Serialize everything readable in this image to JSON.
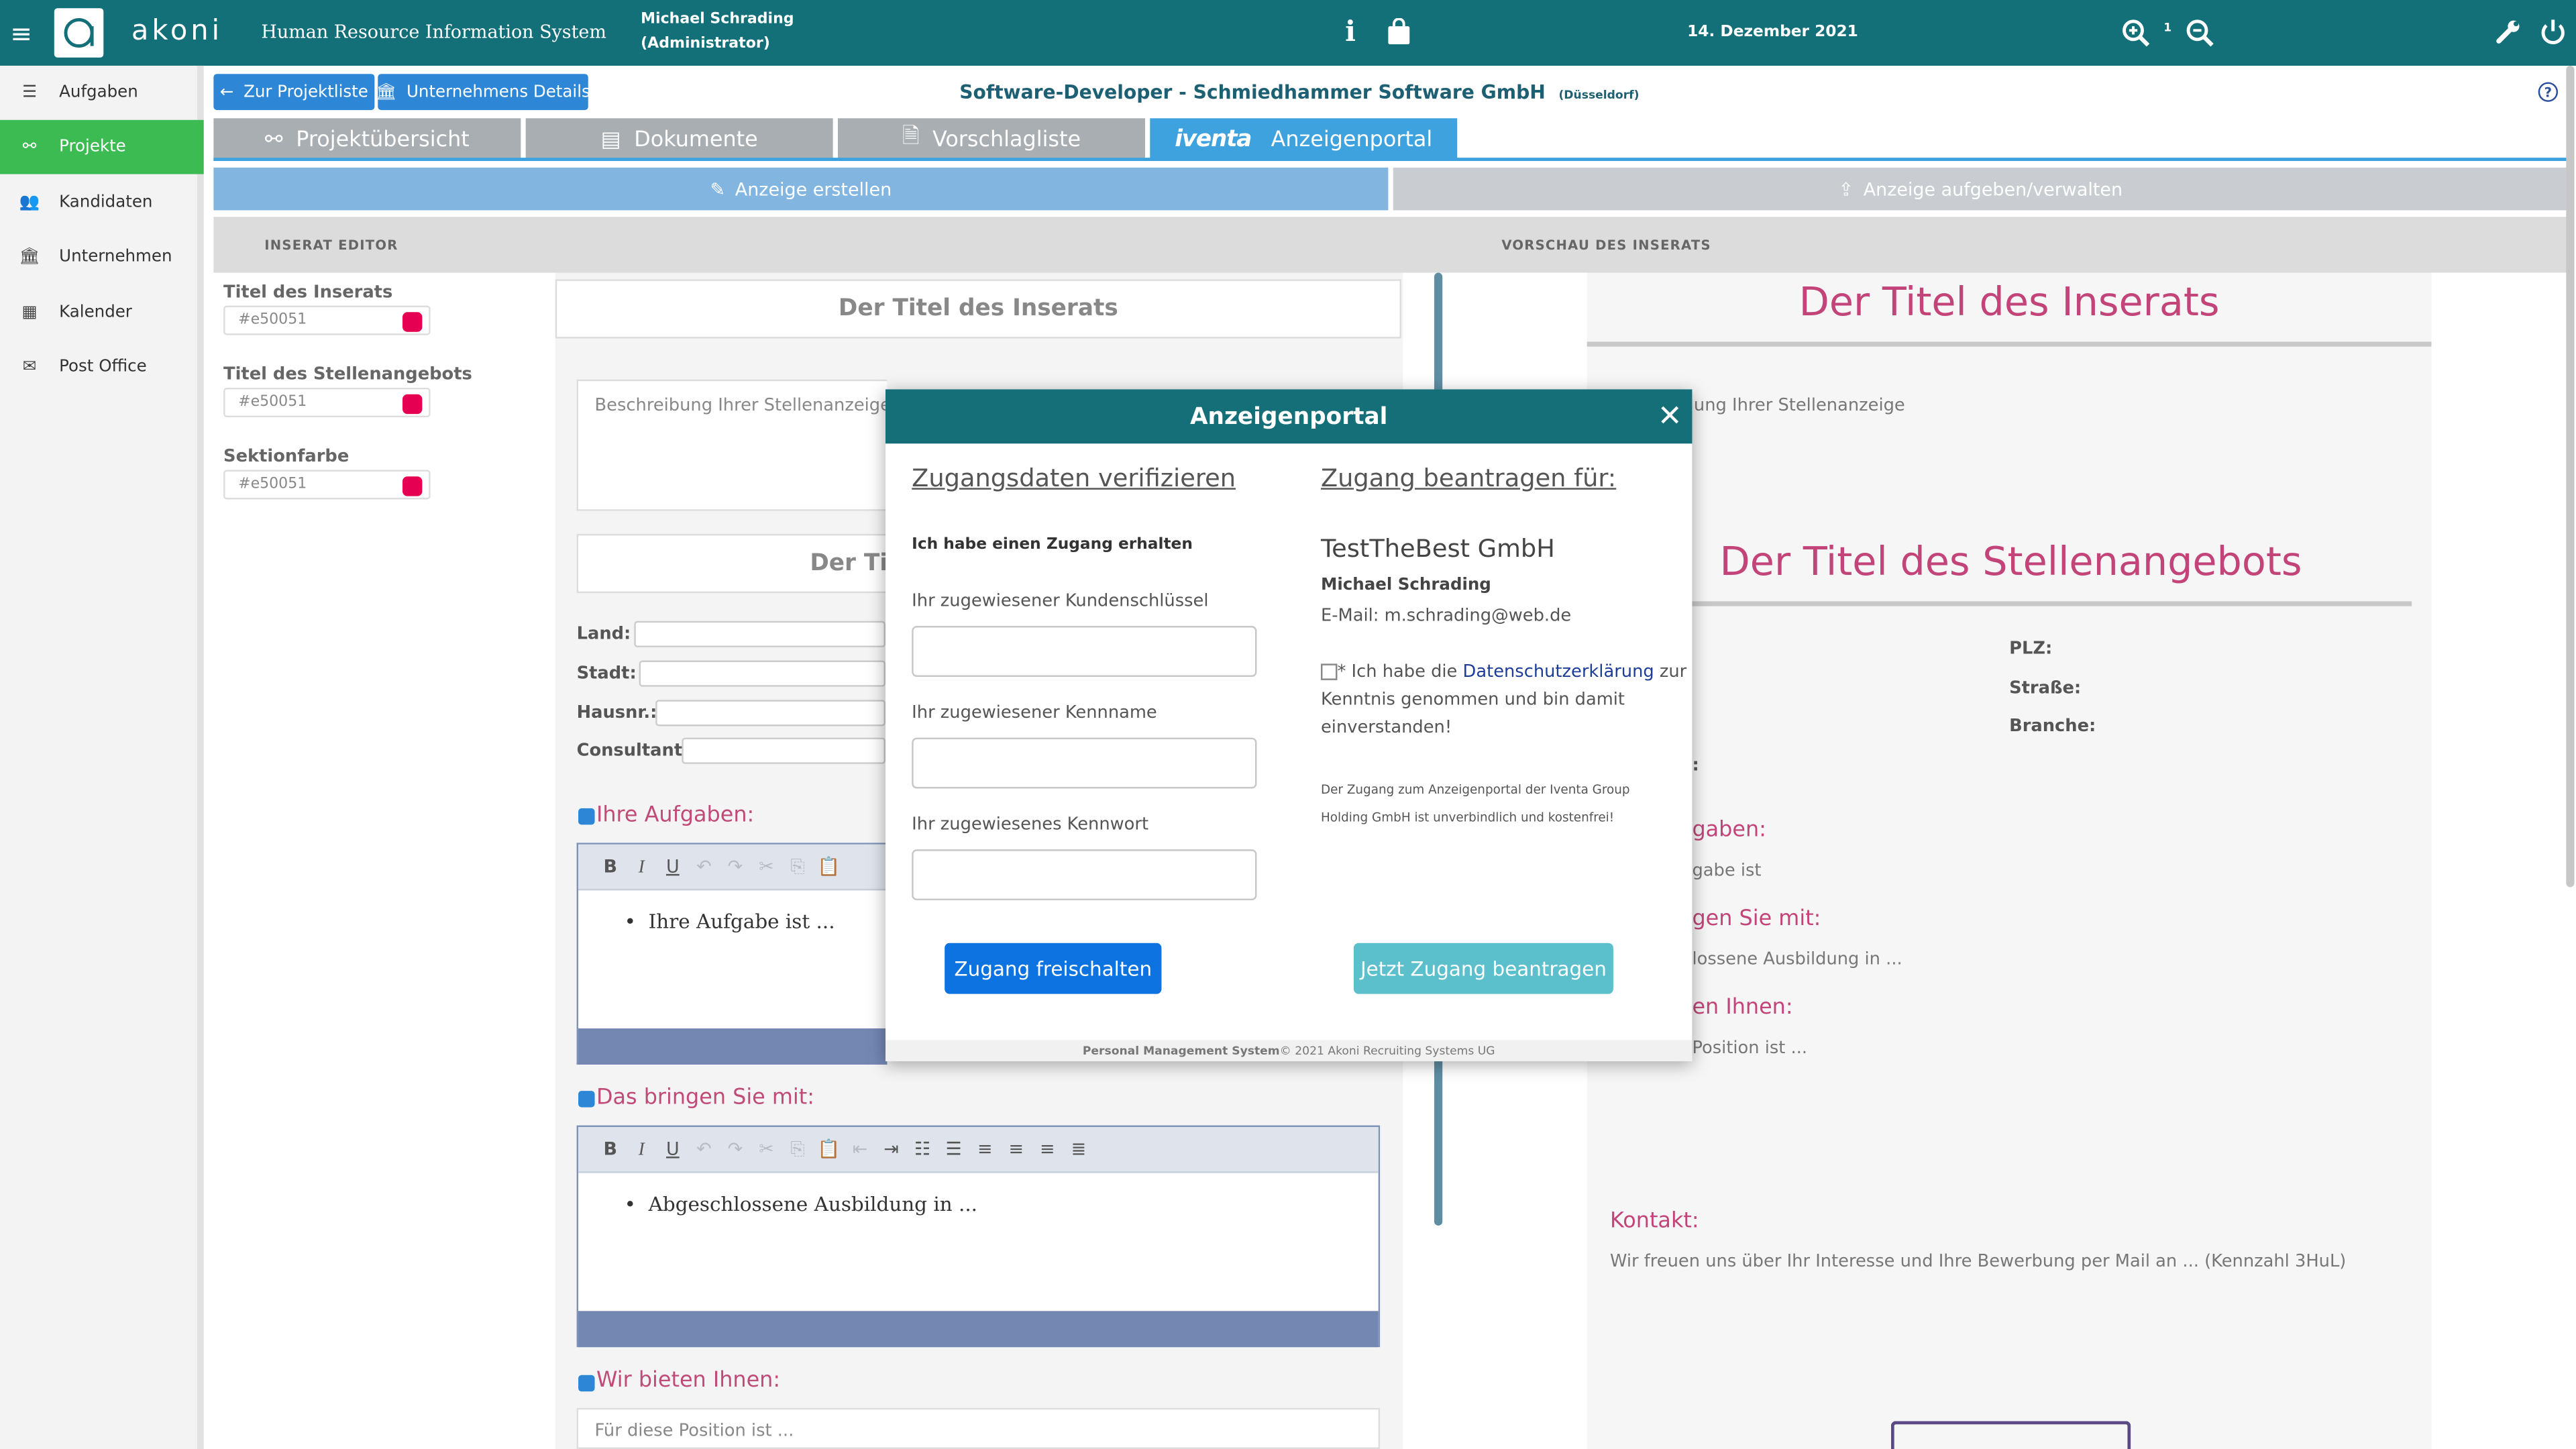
{
  "app": {
    "logo_text": "akoni",
    "subtitle": "Human Resource Information System",
    "user_name": "Michael Schrading",
    "user_role": "(Administrator)",
    "date": "14. Dezember 2021",
    "zoom_level": "1"
  },
  "sidebar": {
    "items": [
      {
        "label": "Aufgaben",
        "icon": "list-icon"
      },
      {
        "label": "Projekte",
        "icon": "project-icon",
        "active": true
      },
      {
        "label": "Kandidaten",
        "icon": "users-icon"
      },
      {
        "label": "Unternehmen",
        "icon": "bank-icon"
      },
      {
        "label": "Kalender",
        "icon": "calendar-icon"
      },
      {
        "label": "Post Office",
        "icon": "envelope-icon"
      }
    ]
  },
  "header": {
    "back_button": "Zur Projektliste",
    "company_button": "Unternehmens Details",
    "project_title": "Software-Developer - Schmiedhammer Software GmbH",
    "project_location": "(Düsseldorf)"
  },
  "tabs": [
    {
      "label": "Projektübersicht"
    },
    {
      "label": "Dokumente"
    },
    {
      "label": "Vorschlagliste"
    },
    {
      "label": "Anzeigenportal",
      "brand": "iventa",
      "active": true
    }
  ],
  "subtabs": {
    "create": "Anzeige erstellen",
    "manage": "Anzeige aufgeben/verwalten"
  },
  "editor": {
    "section_label": "INSERAT EDITOR",
    "color_fields": [
      {
        "label": "Titel des Inserats",
        "value": "#e50051"
      },
      {
        "label": "Titel des Stellenangebots",
        "value": "#e50051"
      },
      {
        "label": "Sektionfarbe",
        "value": "#e50051"
      }
    ],
    "title_placeholder": "Der Titel des Inserats",
    "description_placeholder": "Beschreibung Ihrer Stellenanzeige",
    "job_title_partial": "Der Tit",
    "form_labels": {
      "land": "Land:",
      "stadt": "Stadt:",
      "hausnr": "Hausnr.:",
      "consultant": "Consultant:"
    },
    "sections": [
      {
        "title": "Ihre Aufgaben:",
        "content": "Ihre Aufgabe ist ..."
      },
      {
        "title": "Das bringen Sie mit:",
        "content": "Abgeschlossene Ausbildung in ..."
      },
      {
        "title": "Wir bieten Ihnen:",
        "content": "Für diese Position ist ..."
      }
    ]
  },
  "preview": {
    "section_label": "VORSCHAU DES INSERATS",
    "title": "Der Titel des Inserats",
    "description_partial": "ung Ihrer Stellenanzeige",
    "job_title": "Der Titel des Stellenangebots",
    "plz_label": "PLZ:",
    "strasse_label": "Straße:",
    "branche_label": "Branche:",
    "partial_colon": ":",
    "sec1_partial": "gaben:",
    "sec1_text_partial": "gabe ist",
    "sec2_partial": "gen Sie mit:",
    "sec2_text_partial": "lossene Ausbildung in ...",
    "sec3_partial": "en Ihnen:",
    "sec3_text_partial": "Position ist ...",
    "contact_title": "Kontakt:",
    "contact_text": "Wir freuen uns über Ihr Interesse und Ihre Bewerbung per Mail an ... (Kennzahl 3HuL)"
  },
  "modal": {
    "title": "Anzeigenportal",
    "left_heading": "Zugangsdaten verifizieren",
    "have_access": "Ich habe einen Zugang erhalten",
    "customer_key_label": "Ihr zugewiesener Kundenschlüssel",
    "username_label": "Ihr zugewiesener Kennname",
    "password_label": "Ihr zugewiesenes Kennwort",
    "unlock_button": "Zugang freischalten",
    "right_heading": "Zugang beantragen für:",
    "company": "TestTheBest GmbH",
    "contact_name": "Michael Schrading",
    "email": "E-Mail: m.schrading@web.de",
    "privacy_pre": "* Ich habe die ",
    "privacy_link": "Datenschutzerklärung",
    "privacy_post": " zur",
    "privacy_line2": "Kenntnis genommen und bin damit",
    "privacy_line3": "einverstanden!",
    "note_line1": "Der Zugang zum Anzeigenportal der Iventa Group",
    "note_line2": "Holding GmbH ist unverbindlich und kostenfrei!",
    "request_button": "Jetzt Zugang beantragen",
    "footer_bold": "Personal Management System",
    "footer_rest": " © 2021 Akoni Recruiting Systems UG"
  },
  "colors": {
    "topbar": "#136f78",
    "sidebar_active": "#3dbb53",
    "accent_blue": "#2e87d6",
    "tab_active": "#3ea2df",
    "section_pink": "#c04a78",
    "swatch": "#e50051",
    "request_button": "#5bc0cb"
  }
}
